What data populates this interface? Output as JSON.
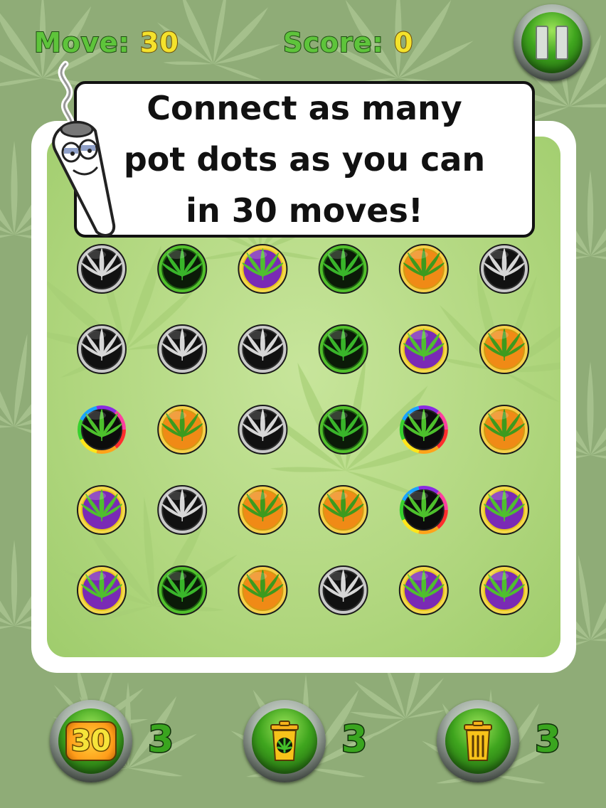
{
  "hud": {
    "move_label": "Move:",
    "move_value": "30",
    "score_label": "Score:",
    "score_value": "0"
  },
  "tutorial": {
    "lines": [
      "Connect as many",
      "pot dots as you can",
      "in 30 moves!"
    ]
  },
  "board": {
    "rows": 5,
    "cols": 6,
    "grid": [
      [
        "silver",
        "green",
        "purple",
        "green",
        "orange",
        "silver"
      ],
      [
        "silver",
        "silver",
        "silver",
        "green",
        "purple",
        "orange"
      ],
      [
        "rainbow",
        "orange",
        "silver",
        "green",
        "rainbow",
        "orange"
      ],
      [
        "purple",
        "silver",
        "orange",
        "orange",
        "rainbow",
        "purple"
      ],
      [
        "purple",
        "green",
        "orange",
        "silver",
        "purple",
        "purple"
      ]
    ]
  },
  "colors": {
    "silver": {
      "ring": "#2b2b2b",
      "fill": "#111111",
      "leaf": "#d6d6d6",
      "rim": "#c9c9c9"
    },
    "green": {
      "ring": "#1d5f10",
      "fill": "#0b1a08",
      "leaf": "#39b52a",
      "rim": "#52c02c"
    },
    "purple": {
      "ring": "#e8c41c",
      "fill": "#7a2ab5",
      "leaf": "#4fbf2e",
      "rim": "#f3d84a"
    },
    "orange": {
      "ring": "#d49a12",
      "fill": "#f08a16",
      "leaf": "#3d9a1e",
      "rim": "#f5d04a"
    },
    "rainbow": {
      "ring": "#222222",
      "fill": "#0c0c0c",
      "leaf": "#4dc02c",
      "rim": "#ff3fa0"
    }
  },
  "powerups": [
    {
      "name": "extra-moves",
      "label": "30",
      "count": "3"
    },
    {
      "name": "clear-color",
      "label": "",
      "count": "3"
    },
    {
      "name": "clear-dot",
      "label": "",
      "count": "3"
    }
  ]
}
